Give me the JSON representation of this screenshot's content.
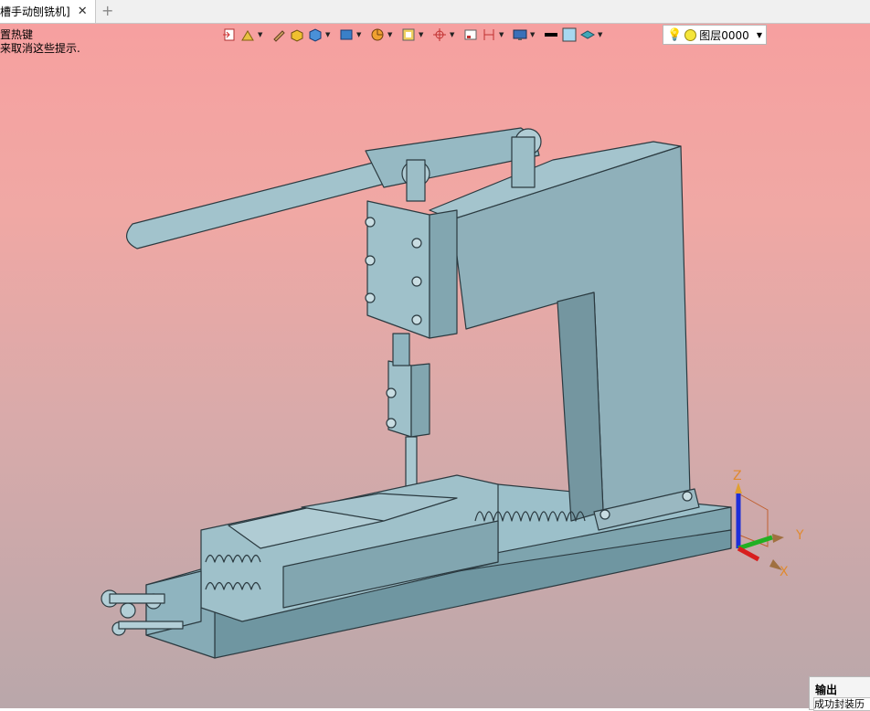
{
  "tab": {
    "label": "槽手动刨铣机]",
    "close_glyph": "✕",
    "new_glyph": "+"
  },
  "hints": [
    "置热键",
    "来取消这些提示."
  ],
  "toolbar": {
    "icons": [
      "import-icon",
      "sketch-icon",
      "edit-icon",
      "shape-icon",
      "solid-box-icon",
      "feature-icon",
      "pie-icon",
      "frame-icon",
      "cross-target-icon",
      "view-icon",
      "dimension-icon",
      "screen-icon",
      "line-color-icon",
      "fill-color-icon",
      "layer-stack-icon"
    ],
    "layer_label": "图层0000"
  },
  "axes": {
    "x": "X",
    "y": "Y",
    "z": "Z",
    "x_color": "#d81e1e",
    "y_color": "#22b022",
    "z_color": "#1e2ed8"
  },
  "model_color": "#8fb4bf",
  "output": {
    "title": "输出",
    "line": "成功封装历"
  }
}
